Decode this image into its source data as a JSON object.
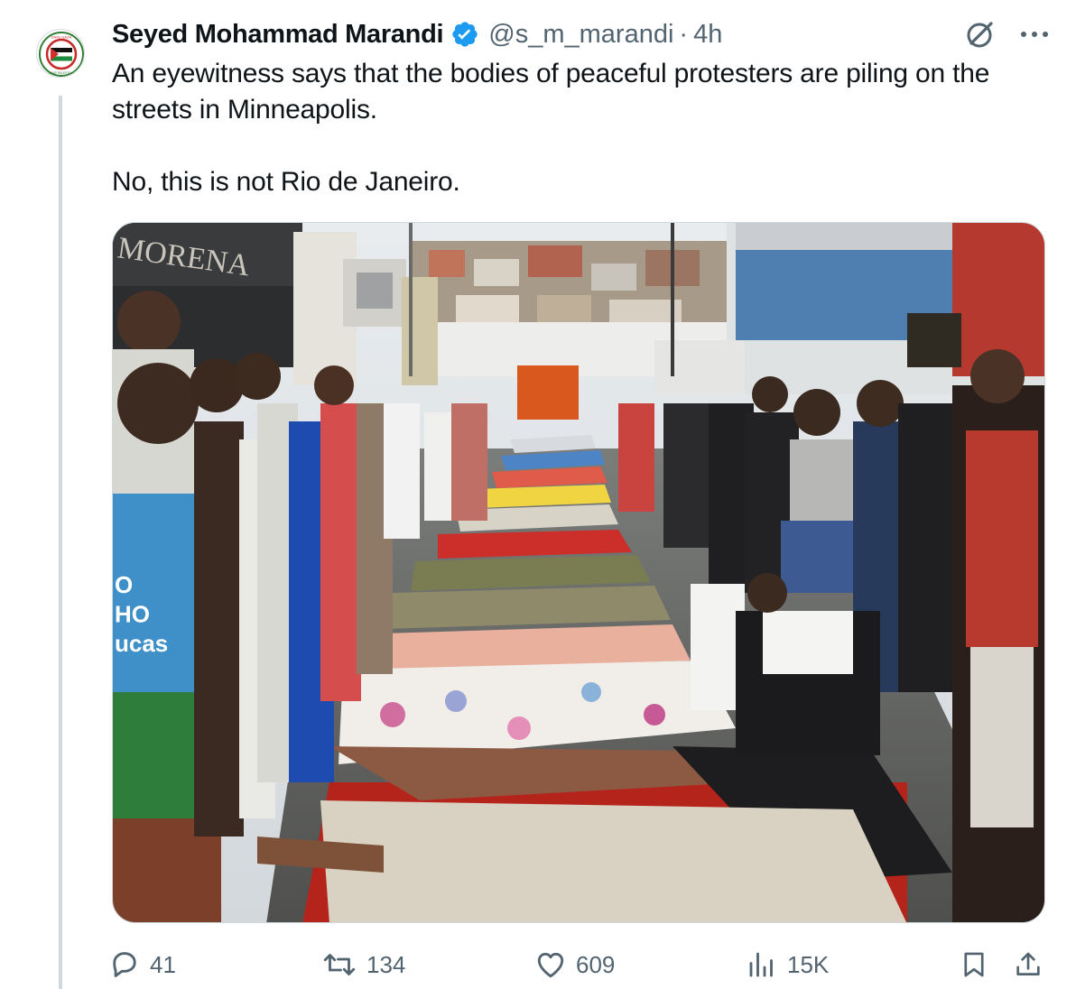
{
  "author": {
    "display_name": "Seyed Mohammad Marandi",
    "handle": "@s_m_marandi",
    "separator": "·",
    "time": "4h",
    "verified": true,
    "avatar_icon": "save-gaza-save-palestine-badge",
    "avatar_text_top": "SAVE GAZA",
    "avatar_text_bottom": "SAVE PALESTINE"
  },
  "tweet": {
    "text": "An eyewitness says that the bodies of peaceful protesters are piling on the streets in Minneapolis.\n\nNo, this is not Rio de Janeiro."
  },
  "media": {
    "storefront_sign": "MORENA",
    "shirt_text": "O\nHO\nucas"
  },
  "actions": {
    "replies": "41",
    "reposts": "134",
    "likes": "609",
    "views": "15K"
  },
  "colors": {
    "text": "#0f1419",
    "secondary": "#536471",
    "verified": "#1d9bf0",
    "border": "#cfd9de"
  }
}
